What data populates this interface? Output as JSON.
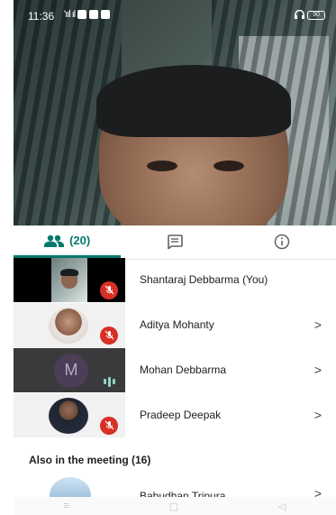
{
  "status": {
    "time": "11:36",
    "signal": "'ııl ıl",
    "battery": "90"
  },
  "tabs": [
    {
      "id": "people",
      "icon": "people-icon",
      "label": "(20)"
    },
    {
      "id": "chat",
      "icon": "chat-icon",
      "label": ""
    },
    {
      "id": "info",
      "icon": "info-icon",
      "label": ""
    }
  ],
  "participants": [
    {
      "name": "Shantaraj Debbarma (You)",
      "muted": true,
      "avatar": "self-video"
    },
    {
      "name": "Aditya Mohanty",
      "muted": true,
      "avatar": "photo"
    },
    {
      "name": "Mohan Debbarma",
      "muted": false,
      "speaking": true,
      "avatar": "letter",
      "initial": "M"
    },
    {
      "name": "Pradeep Deepak",
      "muted": true,
      "avatar": "photo"
    }
  ],
  "also_section": "Also in the meeting (16)",
  "partial_participant": "Babudhan Tripura",
  "nav": [
    "≡",
    "▢",
    "◁"
  ],
  "colors": {
    "accent": "#00796b",
    "muted": "#d93025"
  }
}
